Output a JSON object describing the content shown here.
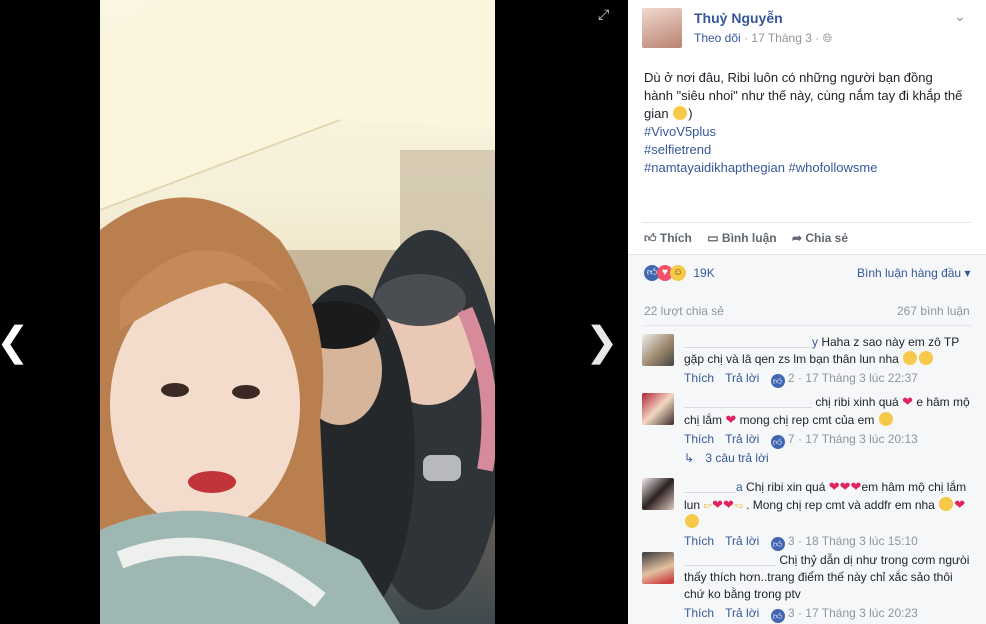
{
  "post": {
    "author": "Thuỷ Nguyễn",
    "follow_label": "Theo dõi",
    "date": "17 Tháng 3",
    "separator": "·",
    "text": "Dù ở nơi đâu, Ribi luôn có những người bạn đồng hành \"siêu nhoi\" như thế này, cùng nắm tay đi khắp thế gian",
    "text_end": ")",
    "hashtags": [
      "#VivoV5plus",
      "#selfietrend",
      "#namtayaidikhapthegian #whofollowsme"
    ]
  },
  "actions": {
    "like": "Thích",
    "comment": "Bình luận",
    "share": "Chia sẻ"
  },
  "stats": {
    "reactions_count": "19K",
    "sort_label": "Bình luận hàng đầu",
    "shares": "22 lượt chia sẻ",
    "comments": "267 bình luận"
  },
  "comments": [
    {
      "name": "y",
      "text": "Haha z sao này em zô TP gặp chị và lâ qen zs lm bạn thân lun nha",
      "like": "Thích",
      "reply": "Trả lời",
      "likes": "2",
      "date": "17 Tháng 3 lúc 22:37"
    },
    {
      "name": "",
      "text_a": "chị ribi xinh quá",
      "text_b": "e hâm mộ chị lắm",
      "text_c": "mong chị rep cmt của em",
      "like": "Thích",
      "reply": "Trả lời",
      "likes": "7",
      "date": "17 Tháng 3 lúc 20:13",
      "replies": "3 câu trả lời"
    },
    {
      "name": "a",
      "text_a": "Chị ribi xin quá",
      "text_b": "em hâm mộ chị lắm lun",
      "text_c": ". Mong chị rep cmt và addfr em nha",
      "like": "Thích",
      "reply": "Trả lời",
      "likes": "3",
      "date": "18 Tháng 3 lúc 15:10"
    },
    {
      "name": "",
      "text": "Chị thỷ dẫn dị như trong cơm ngưòi thấy thích hơn..trang điểm thế này chỉ xắc sảo thôi chứ ko bằng trong ptv",
      "like": "Thích",
      "reply": "Trả lời",
      "likes": "3",
      "date": "17 Tháng 3 lúc 20:23"
    }
  ],
  "colors": {
    "link": "#365899",
    "muted": "#90949c",
    "background": "#000000",
    "panel": "#ffffff"
  }
}
